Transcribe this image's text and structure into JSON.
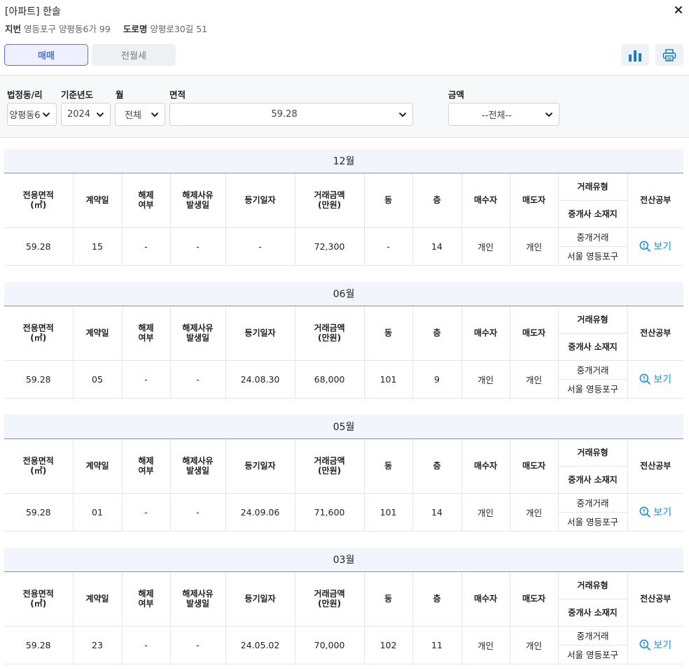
{
  "header": {
    "title": "[아파트] 한솔",
    "jibun_label": "지번",
    "jibun_value": "영등포구 양평동6가 99",
    "road_label": "도로명",
    "road_value": "양평로30길 51"
  },
  "tabs": [
    {
      "label": "매매",
      "active": true
    },
    {
      "label": "전월세",
      "active": false
    }
  ],
  "icons": {
    "close": "close-icon",
    "chart": "bar-chart-icon",
    "print": "printer-icon"
  },
  "colors": {
    "accent": "#5a6cd6",
    "link": "#1e8fd8"
  },
  "filters": {
    "dong_label": "법정동/리",
    "dong_value": "양평동6",
    "year_label": "기준년도",
    "year_value": "2024",
    "month_label": "월",
    "month_value": "전체",
    "area_label": "면적",
    "area_value": "59.28",
    "price_label": "금액",
    "price_value": "--전체--"
  },
  "columns": {
    "area": "전용면적\n(㎡)",
    "contract_day": "계약일",
    "cancel": "해제\n여부",
    "cancel_date": "해제사유\n발생일",
    "reg_date": "등기일자",
    "price": "거래금액\n(만원)",
    "dong": "동",
    "floor": "층",
    "buyer": "매수자",
    "seller": "매도자",
    "deal_type": "거래유형",
    "agent_loc": "중개사 소재지",
    "docs": "전산공부"
  },
  "view_label": "보기",
  "sections": [
    {
      "month": "12월",
      "area": "59.28",
      "day": "15",
      "cancel": "-",
      "cancel_date": "-",
      "reg_date": "-",
      "price": "72,300",
      "dong": "-",
      "floor": "14",
      "buyer": "개인",
      "seller": "개인",
      "deal_type": "중개거래",
      "agent_loc": "서울 영등포구"
    },
    {
      "month": "06월",
      "area": "59.28",
      "day": "05",
      "cancel": "-",
      "cancel_date": "-",
      "reg_date": "24.08.30",
      "price": "68,000",
      "dong": "101",
      "floor": "9",
      "buyer": "개인",
      "seller": "개인",
      "deal_type": "중개거래",
      "agent_loc": "서울 영등포구"
    },
    {
      "month": "05월",
      "area": "59.28",
      "day": "01",
      "cancel": "-",
      "cancel_date": "-",
      "reg_date": "24.09.06",
      "price": "71,600",
      "dong": "101",
      "floor": "14",
      "buyer": "개인",
      "seller": "개인",
      "deal_type": "중개거래",
      "agent_loc": "서울 영등포구"
    },
    {
      "month": "03월",
      "area": "59.28",
      "day": "23",
      "cancel": "-",
      "cancel_date": "-",
      "reg_date": "24.05.02",
      "price": "70,000",
      "dong": "102",
      "floor": "11",
      "buyer": "개인",
      "seller": "개인",
      "deal_type": "중개거래",
      "agent_loc": "서울 영등포구"
    }
  ]
}
